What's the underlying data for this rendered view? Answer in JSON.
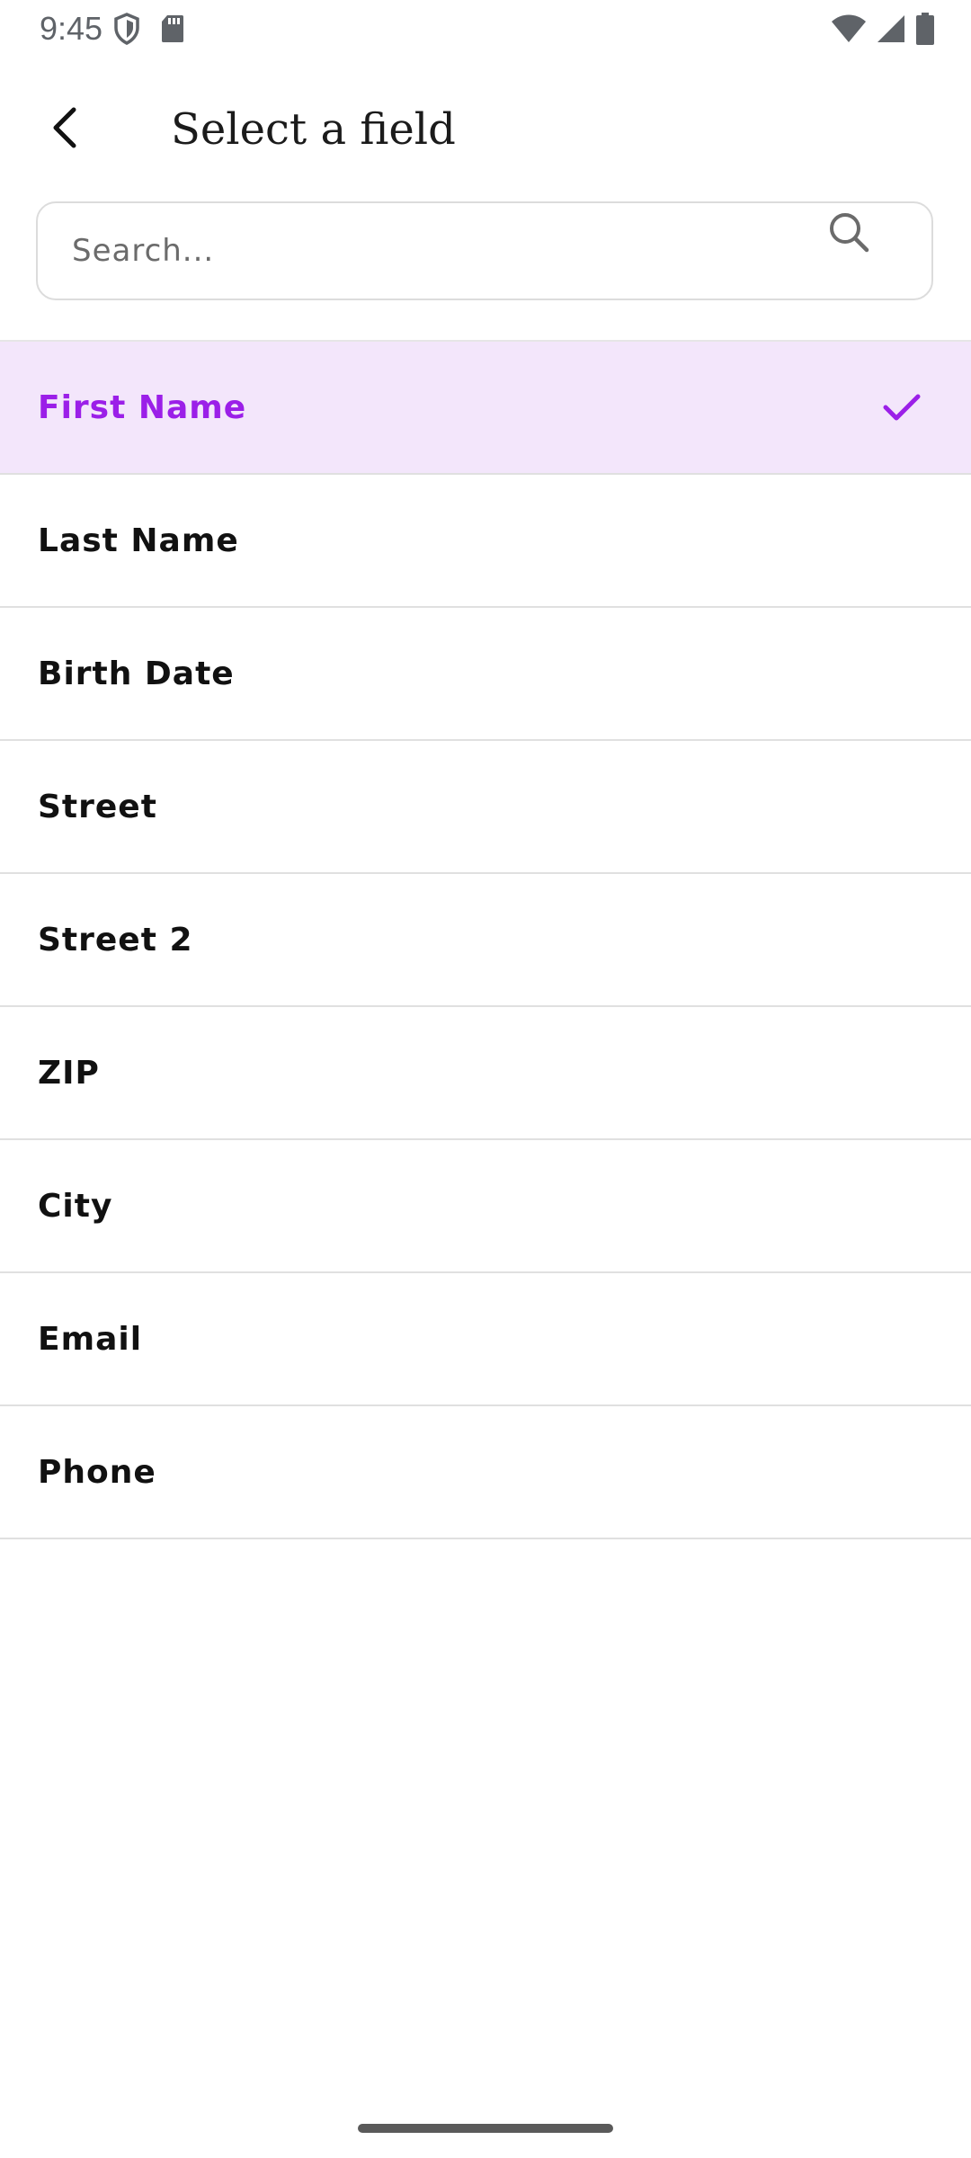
{
  "status_bar": {
    "time": "9:45",
    "left_icons": [
      "shield-icon",
      "sd-card-icon"
    ],
    "right_icons": [
      "wifi-icon",
      "cellular-signal-icon",
      "battery-icon"
    ]
  },
  "header": {
    "title": "Select a field",
    "back_icon": "chevron-left-icon"
  },
  "search": {
    "placeholder": "Search...",
    "value": "",
    "icon": "search-icon"
  },
  "fields": [
    {
      "label": "First Name",
      "selected": true
    },
    {
      "label": "Last Name",
      "selected": false
    },
    {
      "label": "Birth Date",
      "selected": false
    },
    {
      "label": "Street",
      "selected": false
    },
    {
      "label": "Street 2",
      "selected": false
    },
    {
      "label": "ZIP",
      "selected": false
    },
    {
      "label": "City",
      "selected": false
    },
    {
      "label": "Email",
      "selected": false
    },
    {
      "label": "Phone",
      "selected": false
    }
  ],
  "colors": {
    "accent": "#9b1fe8",
    "selected_background": "#f3e6fb",
    "divider": "#e0e0e0"
  }
}
